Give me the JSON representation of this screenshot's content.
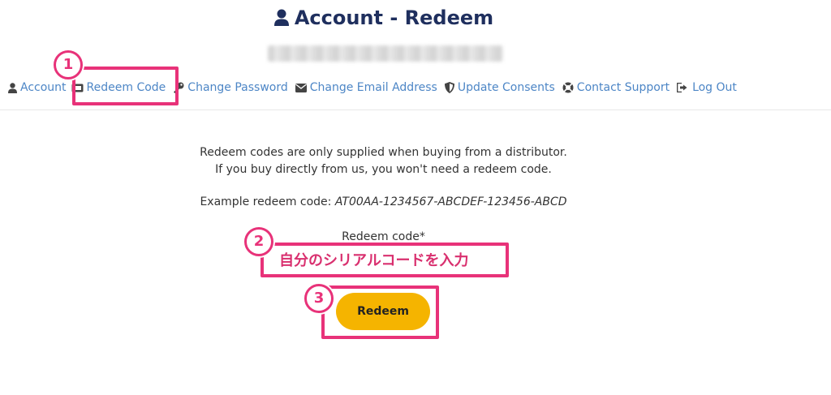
{
  "header": {
    "title": "Account - Redeem",
    "title_icon": "user-icon"
  },
  "nav": {
    "items": [
      {
        "label": "Account",
        "icon": "user-icon"
      },
      {
        "label": "Redeem Code",
        "icon": "ticket-icon"
      },
      {
        "label": "Change Password",
        "icon": "key-icon"
      },
      {
        "label": "Change Email Address",
        "icon": "envelope-icon"
      },
      {
        "label": "Update Consents",
        "icon": "shield-icon"
      },
      {
        "label": "Contact Support",
        "icon": "lifebuoy-icon"
      },
      {
        "label": "Log Out",
        "icon": "sign-out-icon"
      }
    ]
  },
  "main": {
    "info_line1": "Redeem codes are only supplied when buying from a distributor.",
    "info_line2": "If you buy directly from us, you won't need a redeem code.",
    "example_prefix": "Example redeem code:",
    "example_code": "AT00AA-1234567-ABCDEF-123456-ABCD",
    "field_label": "Redeem code*",
    "field_value": "自分のシリアルコードを入力",
    "button_label": "Redeem"
  },
  "annotations": {
    "step1": "1",
    "step2": "2",
    "step3": "3",
    "color": "#e83279"
  },
  "colors": {
    "title": "#1f2f5e",
    "link": "#4d86c6",
    "button": "#f5b400"
  }
}
